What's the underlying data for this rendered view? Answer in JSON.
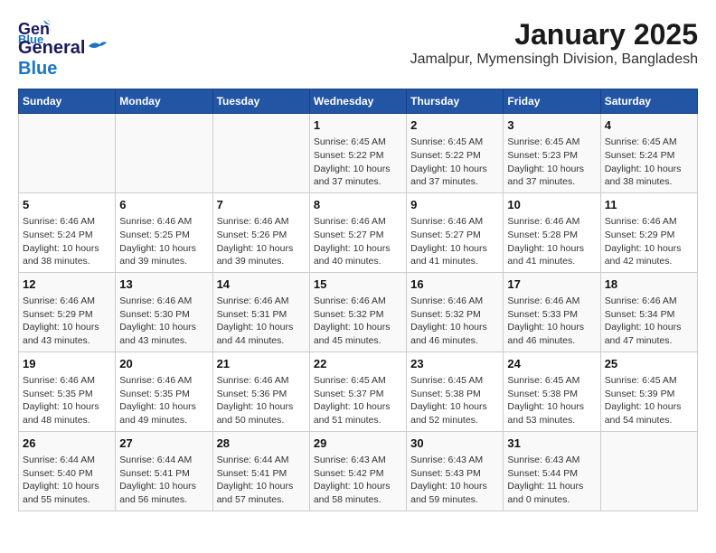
{
  "logo": {
    "line1": "General",
    "line2": "Blue"
  },
  "title": "January 2025",
  "subtitle": "Jamalpur, Mymensingh Division, Bangladesh",
  "days_header": [
    "Sunday",
    "Monday",
    "Tuesday",
    "Wednesday",
    "Thursday",
    "Friday",
    "Saturday"
  ],
  "weeks": [
    [
      {
        "day": "",
        "info": ""
      },
      {
        "day": "",
        "info": ""
      },
      {
        "day": "",
        "info": ""
      },
      {
        "day": "1",
        "info": "Sunrise: 6:45 AM\nSunset: 5:22 PM\nDaylight: 10 hours\nand 37 minutes."
      },
      {
        "day": "2",
        "info": "Sunrise: 6:45 AM\nSunset: 5:22 PM\nDaylight: 10 hours\nand 37 minutes."
      },
      {
        "day": "3",
        "info": "Sunrise: 6:45 AM\nSunset: 5:23 PM\nDaylight: 10 hours\nand 37 minutes."
      },
      {
        "day": "4",
        "info": "Sunrise: 6:45 AM\nSunset: 5:24 PM\nDaylight: 10 hours\nand 38 minutes."
      }
    ],
    [
      {
        "day": "5",
        "info": "Sunrise: 6:46 AM\nSunset: 5:24 PM\nDaylight: 10 hours\nand 38 minutes."
      },
      {
        "day": "6",
        "info": "Sunrise: 6:46 AM\nSunset: 5:25 PM\nDaylight: 10 hours\nand 39 minutes."
      },
      {
        "day": "7",
        "info": "Sunrise: 6:46 AM\nSunset: 5:26 PM\nDaylight: 10 hours\nand 39 minutes."
      },
      {
        "day": "8",
        "info": "Sunrise: 6:46 AM\nSunset: 5:27 PM\nDaylight: 10 hours\nand 40 minutes."
      },
      {
        "day": "9",
        "info": "Sunrise: 6:46 AM\nSunset: 5:27 PM\nDaylight: 10 hours\nand 41 minutes."
      },
      {
        "day": "10",
        "info": "Sunrise: 6:46 AM\nSunset: 5:28 PM\nDaylight: 10 hours\nand 41 minutes."
      },
      {
        "day": "11",
        "info": "Sunrise: 6:46 AM\nSunset: 5:29 PM\nDaylight: 10 hours\nand 42 minutes."
      }
    ],
    [
      {
        "day": "12",
        "info": "Sunrise: 6:46 AM\nSunset: 5:29 PM\nDaylight: 10 hours\nand 43 minutes."
      },
      {
        "day": "13",
        "info": "Sunrise: 6:46 AM\nSunset: 5:30 PM\nDaylight: 10 hours\nand 43 minutes."
      },
      {
        "day": "14",
        "info": "Sunrise: 6:46 AM\nSunset: 5:31 PM\nDaylight: 10 hours\nand 44 minutes."
      },
      {
        "day": "15",
        "info": "Sunrise: 6:46 AM\nSunset: 5:32 PM\nDaylight: 10 hours\nand 45 minutes."
      },
      {
        "day": "16",
        "info": "Sunrise: 6:46 AM\nSunset: 5:32 PM\nDaylight: 10 hours\nand 46 minutes."
      },
      {
        "day": "17",
        "info": "Sunrise: 6:46 AM\nSunset: 5:33 PM\nDaylight: 10 hours\nand 46 minutes."
      },
      {
        "day": "18",
        "info": "Sunrise: 6:46 AM\nSunset: 5:34 PM\nDaylight: 10 hours\nand 47 minutes."
      }
    ],
    [
      {
        "day": "19",
        "info": "Sunrise: 6:46 AM\nSunset: 5:35 PM\nDaylight: 10 hours\nand 48 minutes."
      },
      {
        "day": "20",
        "info": "Sunrise: 6:46 AM\nSunset: 5:35 PM\nDaylight: 10 hours\nand 49 minutes."
      },
      {
        "day": "21",
        "info": "Sunrise: 6:46 AM\nSunset: 5:36 PM\nDaylight: 10 hours\nand 50 minutes."
      },
      {
        "day": "22",
        "info": "Sunrise: 6:45 AM\nSunset: 5:37 PM\nDaylight: 10 hours\nand 51 minutes."
      },
      {
        "day": "23",
        "info": "Sunrise: 6:45 AM\nSunset: 5:38 PM\nDaylight: 10 hours\nand 52 minutes."
      },
      {
        "day": "24",
        "info": "Sunrise: 6:45 AM\nSunset: 5:38 PM\nDaylight: 10 hours\nand 53 minutes."
      },
      {
        "day": "25",
        "info": "Sunrise: 6:45 AM\nSunset: 5:39 PM\nDaylight: 10 hours\nand 54 minutes."
      }
    ],
    [
      {
        "day": "26",
        "info": "Sunrise: 6:44 AM\nSunset: 5:40 PM\nDaylight: 10 hours\nand 55 minutes."
      },
      {
        "day": "27",
        "info": "Sunrise: 6:44 AM\nSunset: 5:41 PM\nDaylight: 10 hours\nand 56 minutes."
      },
      {
        "day": "28",
        "info": "Sunrise: 6:44 AM\nSunset: 5:41 PM\nDaylight: 10 hours\nand 57 minutes."
      },
      {
        "day": "29",
        "info": "Sunrise: 6:43 AM\nSunset: 5:42 PM\nDaylight: 10 hours\nand 58 minutes."
      },
      {
        "day": "30",
        "info": "Sunrise: 6:43 AM\nSunset: 5:43 PM\nDaylight: 10 hours\nand 59 minutes."
      },
      {
        "day": "31",
        "info": "Sunrise: 6:43 AM\nSunset: 5:44 PM\nDaylight: 11 hours\nand 0 minutes."
      },
      {
        "day": "",
        "info": ""
      }
    ]
  ]
}
